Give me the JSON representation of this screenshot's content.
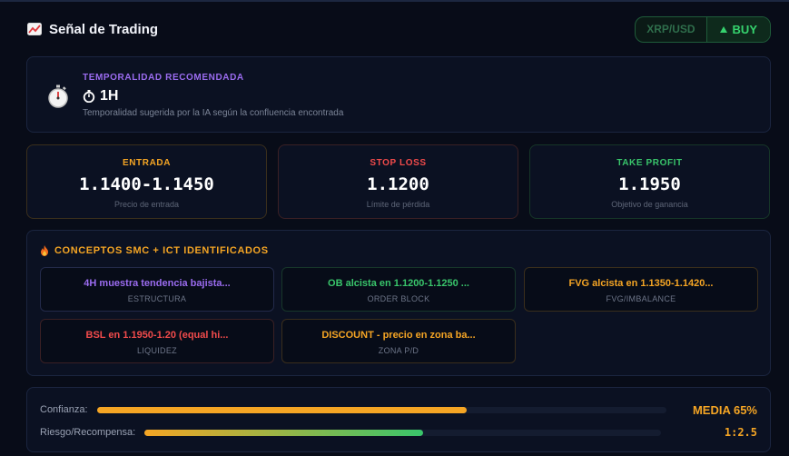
{
  "header": {
    "title": "Señal de Trading",
    "title_icon": "chart-icon",
    "pair": "XRP/USD",
    "direction": "BUY"
  },
  "timeframe": {
    "label": "TEMPORALIDAD RECOMENDADA",
    "value": "1H",
    "description": "Temporalidad sugerida por la IA según la confluencia encontrada",
    "icon": "stopwatch-icon"
  },
  "prices": {
    "entry": {
      "label": "ENTRADA",
      "value": "1.1400-1.1450",
      "sub": "Precio de entrada"
    },
    "stop": {
      "label": "STOP LOSS",
      "value": "1.1200",
      "sub": "Límite de pérdida"
    },
    "take": {
      "label": "TAKE PROFIT",
      "value": "1.1950",
      "sub": "Objetivo de ganancia"
    }
  },
  "smc": {
    "title": "CONCEPTOS SMC + ICT IDENTIFICADOS",
    "items": [
      {
        "text": "4H muestra tendencia bajista...",
        "category": "ESTRUCTURA"
      },
      {
        "text": "OB alcista en 1.1200-1.1250 ...",
        "category": "ORDER BLOCK"
      },
      {
        "text": "FVG alcista en 1.1350-1.1420...",
        "category": "FVG/IMBALANCE"
      },
      {
        "text": "BSL en 1.1950-1.20 (equal hi...",
        "category": "LIQUIDEZ"
      },
      {
        "text": "DISCOUNT - precio en zona ba...",
        "category": "ZONA P/D"
      }
    ]
  },
  "meters": {
    "confidence": {
      "label": "Confianza:",
      "value": "MEDIA 65%",
      "fill": 0.65
    },
    "risk_reward": {
      "label": "Riesgo/Recompensa:",
      "value": "1:2.5",
      "fill": 0.54
    }
  },
  "colors": {
    "accent_orange": "#f5a524",
    "accent_green": "#39c56b",
    "accent_red": "#f24b4b",
    "accent_purple": "#9b6cf0"
  }
}
